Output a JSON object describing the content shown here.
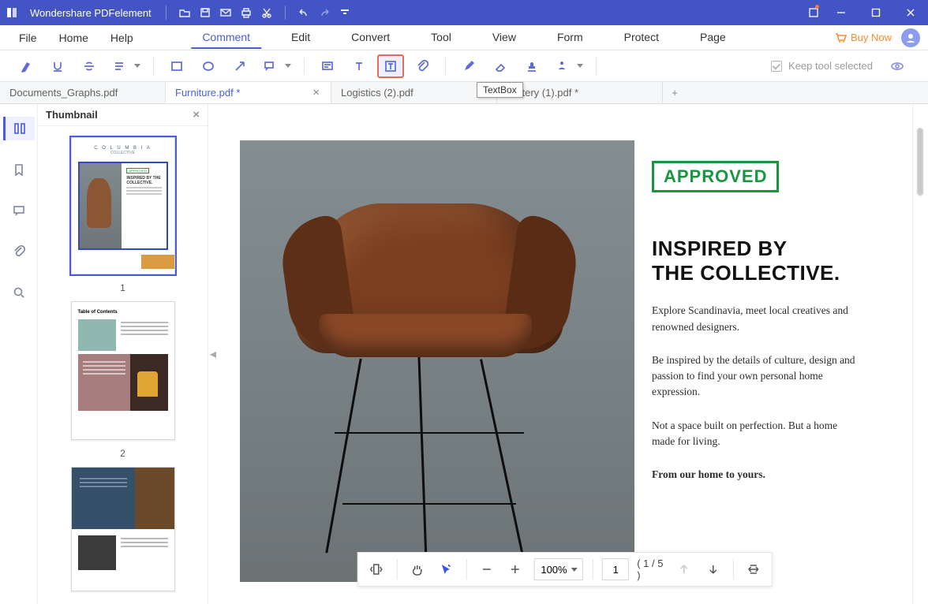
{
  "app": {
    "name": "Wondershare PDFelement"
  },
  "menubar": {
    "left": [
      "File",
      "Home",
      "Help"
    ],
    "center": [
      "Comment",
      "Edit",
      "Convert",
      "Tool",
      "View",
      "Form",
      "Protect",
      "Page"
    ],
    "active": "Comment",
    "buy_now": "Buy Now"
  },
  "toolbar": {
    "tooltip": "TextBox",
    "keep_tool": "Keep tool selected"
  },
  "tabs": [
    {
      "label": "Documents_Graphs.pdf",
      "active": false,
      "closeable": false
    },
    {
      "label": "Furniture.pdf *",
      "active": true,
      "closeable": true
    },
    {
      "label": "Logistics (2).pdf",
      "active": false,
      "closeable": false
    },
    {
      "label": "Pottery (1).pdf *",
      "active": false,
      "closeable": false
    }
  ],
  "thumbnail_panel": {
    "title": "Thumbnail",
    "nums": [
      "1",
      "2"
    ]
  },
  "thumb1": {
    "brand": "C O L U M B I A",
    "sub": "COLLECTIVE",
    "stamp": "APPROVED",
    "h": "INSPIRED BY THE COLLECTIVE."
  },
  "thumb2": {
    "toc": "Table of Contents"
  },
  "document": {
    "stamp": "APPROVED",
    "heading_l1": "INSPIRED BY",
    "heading_l2": "THE COLLECTIVE.",
    "p1": "Explore Scandinavia, meet local creatives and renowned designers.",
    "p2": "Be inspired by the details of culture, design and passion to find your own personal home expression.",
    "p3": "Not a space built on perfection. But a home made for living.",
    "p4": "From our home to yours."
  },
  "page_controls": {
    "zoom": "100%",
    "page_input": "1",
    "page_count": "( 1 / 5 )"
  }
}
